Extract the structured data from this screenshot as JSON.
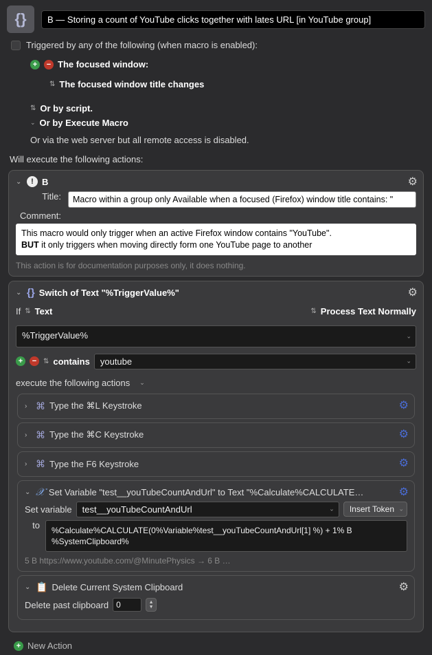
{
  "header": {
    "title": "B — Storing a count of YouTube clicks together with lates URL [in YouTube group]"
  },
  "trigger": {
    "header": "Triggered by any of the following (when macro is enabled):",
    "focused_window": "The focused window:",
    "window_title_changes": "The focused window title changes",
    "or_by_script": "Or by script.",
    "or_by_execute_macro": "Or by Execute Macro",
    "or_via_web": "Or via the web server but all remote access is disabled."
  },
  "will_execute": "Will execute the following actions:",
  "action_b": {
    "name": "B",
    "title_label": "Title:",
    "title_value": "Macro within a group only Available when a focused (Firefox) window title contains: \"",
    "comment_label": "Comment:",
    "comment_line1": "This macro would only trigger when an active Firefox window contains \"YouTube\".",
    "comment_bold": "BUT",
    "comment_line2": " it only triggers when moving directly form one YouTube page to another",
    "footer": "This action is for documentation purposes only, it does nothing."
  },
  "switch_action": {
    "header": "Switch of Text \"%TriggerValue%\"",
    "if_label": "If",
    "text_label": "Text",
    "process": "Process Text Normally",
    "trigger_value": "%TriggerValue%",
    "contains_label": "contains",
    "contains_value": "youtube",
    "execute_label": "execute the following actions",
    "sub_actions": {
      "type_l": "Type the ⌘L Keystroke",
      "type_c": "Type the ⌘C Keystroke",
      "type_f6": "Type the F6 Keystroke",
      "set_var": {
        "header": "Set Variable \"test__youTubeCountAndUrl\" to Text \"%Calculate%CALCULATE…",
        "set_variable_label": "Set variable",
        "variable_name": "test__youTubeCountAndUrl",
        "insert_token": "Insert Token",
        "to_label": "to",
        "to_value": "%Calculate%CALCULATE(0%Variable%test__youTubeCountAndUrl[1] %) + 1% B %SystemClipboard%",
        "footer": "5 B https://www.youtube.com/@MinutePhysics → 6 B …"
      },
      "delete_clip": {
        "header": "Delete Current System Clipboard",
        "delete_past_label": "Delete past clipboard",
        "value": "0"
      }
    }
  },
  "new_action": "New Action"
}
